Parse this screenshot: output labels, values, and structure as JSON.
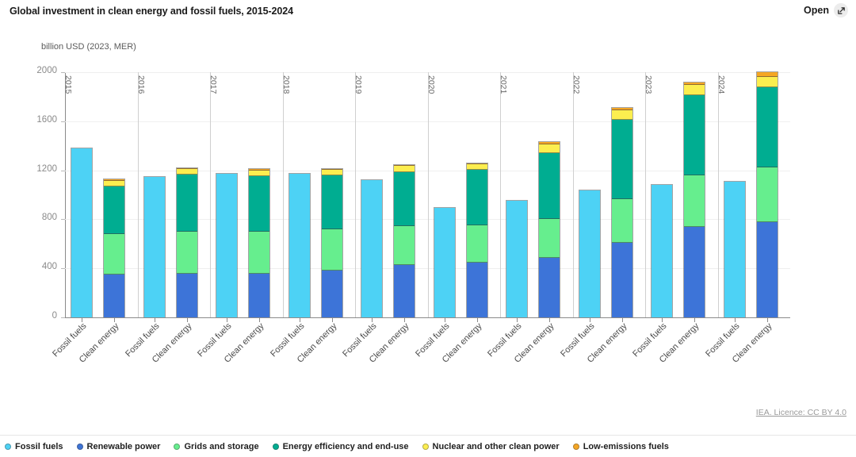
{
  "header": {
    "title": "Global investment in clean energy and fossil fuels, 2015-2024",
    "open_label": "Open",
    "open_icon": "expand-arrow-icon"
  },
  "footer": {
    "licence": "IEA. Licence: CC BY 4.0"
  },
  "chart_data": {
    "type": "bar",
    "title": "Global investment in clean energy and fossil fuels, 2015-2024",
    "subtitle": "billion USD (2023, MER)",
    "xlabel": "",
    "ylabel": "billion USD (2023, MER)",
    "ylim": [
      0,
      2000
    ],
    "yticks": [
      0,
      400,
      800,
      1200,
      1600,
      2000
    ],
    "grid": true,
    "stacked": true,
    "legend_position": "bottom",
    "groups": [
      "2015",
      "2016",
      "2017",
      "2018",
      "2019",
      "2020",
      "2021",
      "2022",
      "2023",
      "2024"
    ],
    "categories": [
      "Fossil fuels",
      "Clean energy"
    ],
    "series": [
      {
        "name": "Fossil fuels",
        "color": "#4DD2F5",
        "applies_to": "Fossil fuels",
        "values": [
          1385,
          1150,
          1180,
          1180,
          1125,
          900,
          960,
          1045,
          1090,
          1115
        ]
      },
      {
        "name": "Renewable power",
        "color": "#3D74D8",
        "applies_to": "Clean energy",
        "values": [
          350,
          355,
          360,
          385,
          430,
          450,
          485,
          610,
          740,
          780
        ]
      },
      {
        "name": "Grids and storage",
        "color": "#66EE8E",
        "applies_to": "Clean energy",
        "values": [
          335,
          350,
          340,
          335,
          320,
          305,
          320,
          360,
          420,
          445
        ]
      },
      {
        "name": "Energy efficiency and end-use",
        "color": "#00AD91",
        "applies_to": "Clean energy",
        "values": [
          390,
          465,
          460,
          445,
          440,
          455,
          540,
          650,
          660,
          660
        ]
      },
      {
        "name": "Nuclear and other clean power",
        "color": "#FCEE4F",
        "applies_to": "Clean energy",
        "values": [
          45,
          45,
          45,
          45,
          50,
          45,
          75,
          75,
          80,
          85
        ]
      },
      {
        "name": "Low-emissions fuels",
        "color": "#F5A623",
        "applies_to": "Clean energy",
        "values": [
          10,
          10,
          10,
          10,
          10,
          10,
          15,
          20,
          25,
          35
        ]
      }
    ],
    "clean_energy_totals": [
      1130,
      1225,
      1215,
      1220,
      1250,
      1265,
      1435,
      1715,
      1925,
      2005
    ]
  }
}
